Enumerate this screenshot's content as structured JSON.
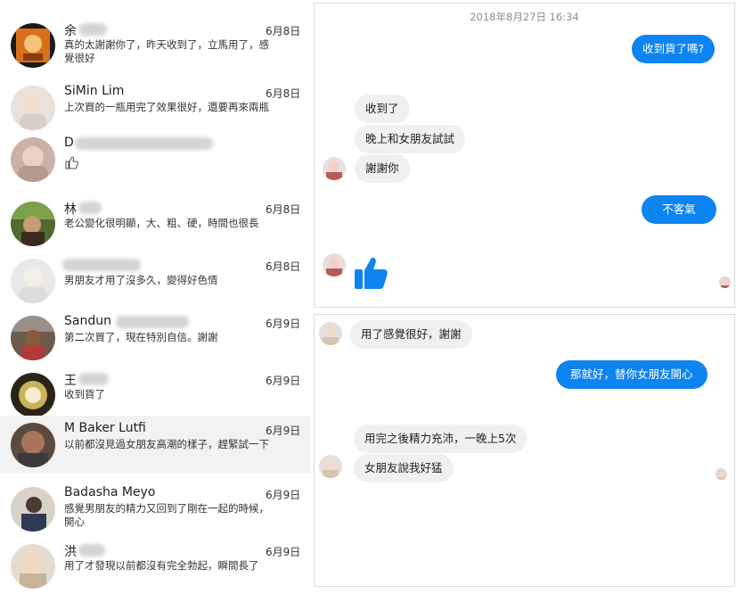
{
  "conversations": [
    {
      "name": "余",
      "date": "6月8日",
      "message": "真的太謝謝你了，昨天收到了，立馬用了，感覺很好"
    },
    {
      "name": "SiMin Lim",
      "date": "6月8日",
      "message": "上次買的一瓶用完了效果很好，還要再來兩瓶"
    },
    {
      "name": "D",
      "date": "",
      "message": "",
      "reaction_icon": "thumbs-up-icon"
    },
    {
      "name": "林",
      "date": "6月8日",
      "message": "老公變化很明顯，大、粗、硬，時間也很長"
    },
    {
      "name": "",
      "date": "6月8日",
      "message": "男朋友才用了沒多久，變得好色情"
    },
    {
      "name": "Sandun",
      "date": "6月9日",
      "message": "第二次買了，現在特別自信。謝謝"
    },
    {
      "name": "王",
      "date": "6月9日",
      "message": "收到貨了"
    },
    {
      "name": "M Baker Lutfi",
      "date": "6月9日",
      "message": "以前都沒見過女朋友高潮的樣子，趕緊試一下",
      "active": true
    },
    {
      "name": "Badasha Meyo",
      "date": "6月9日",
      "message": "感覺男朋友的精力又回到了剛在一起的時候，開心"
    },
    {
      "name": "洪",
      "date": "6月9日",
      "message": "用了才發現以前都沒有完全勃起，瞬間長了"
    }
  ],
  "chat_top": {
    "timestamp": "2018年8月27日 16:34",
    "messages": [
      {
        "side": "out",
        "text": "收到貨了嗎?"
      },
      {
        "side": "in",
        "text": "收到了"
      },
      {
        "side": "in",
        "text": "晚上和女朋友試試"
      },
      {
        "side": "in",
        "text": "謝謝你"
      },
      {
        "side": "out",
        "text": "不客氣"
      }
    ],
    "big_reaction_icon": "thumbs-up-icon"
  },
  "chat_bottom": {
    "messages": [
      {
        "side": "in",
        "text": "用了感覺很好，謝謝"
      },
      {
        "side": "out",
        "text": "那就好，替你女朋友開心"
      },
      {
        "side": "in",
        "text": "用完之後精力充沛，一晚上5次"
      },
      {
        "side": "in",
        "text": "女朋友說我好猛"
      }
    ]
  },
  "colors": {
    "accent": "#0d84f0",
    "incoming_bubble": "#f0f0f0",
    "active_row": "#f2f2f2"
  }
}
